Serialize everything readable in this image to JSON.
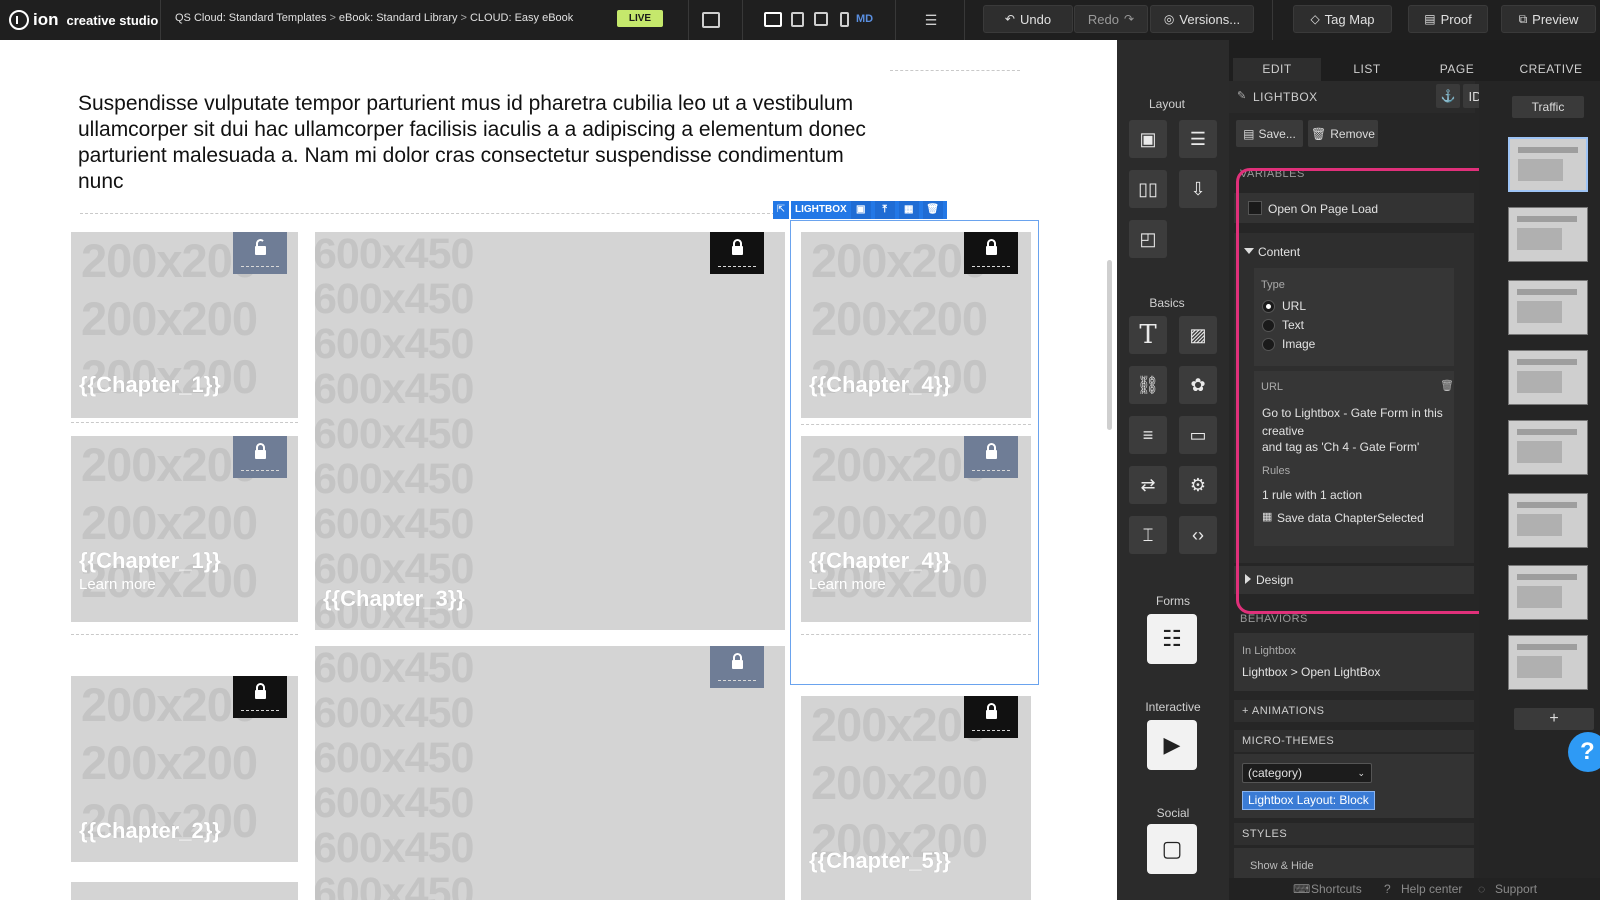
{
  "topbar": {
    "logo": "ion",
    "logo_sub": "creative studio",
    "breadcrumb": [
      "QS Cloud: Standard Templates",
      "eBook: Standard Library",
      "CLOUD: Easy eBook"
    ],
    "crumb_sep": ">",
    "live": "LIVE",
    "device_label": "MD",
    "undo": "Undo",
    "redo": "Redo",
    "versions": "Versions...",
    "tag_map": "Tag Map",
    "proof": "Proof",
    "preview": "Preview"
  },
  "canvas": {
    "paragraph": "Suspendisse vulputate tempor parturient mus id pharetra cubilia leo ut a vestibulum ullamcorper sit dui hac ullamcorper facilisis iaculis a a adipiscing a elementum donec parturient malesuada a. Nam mi dolor cras consectetur suspendisse condimentum nunc",
    "placeholder_small": "200x200",
    "placeholder_wide": "600x450",
    "lightbox_tag": "LIGHTBOX",
    "tiles": [
      {
        "chapter": "{{Chapter_1}}",
        "learn": ""
      },
      {
        "chapter": "{{Chapter_1}}",
        "learn": "Learn more"
      },
      {
        "chapter": "{{Chapter_2}}",
        "learn": ""
      },
      {
        "chapter": "{{Chapter_3}}",
        "learn": ""
      },
      {
        "chapter": "{{Chapter_4}}",
        "learn": ""
      },
      {
        "chapter": "{{Chapter_4}}",
        "learn": "Learn more"
      },
      {
        "chapter": "{{Chapter_5}}",
        "learn": ""
      }
    ]
  },
  "tools": {
    "layout": "Layout",
    "basics": "Basics",
    "forms": "Forms",
    "interactive": "Interactive",
    "social": "Social"
  },
  "panel": {
    "tabs": [
      "EDIT",
      "LIST",
      "PAGE",
      "CREATIVE"
    ],
    "title": "LIGHTBOX",
    "id_label": "ID",
    "save": "Save...",
    "remove": "Remove",
    "variables": "VARIABLES",
    "open_on_load": "Open On Page Load",
    "content": "Content",
    "type_label": "Type",
    "types": [
      "URL",
      "Text",
      "Image"
    ],
    "url_label": "URL",
    "url_text_1": "Go to Lightbox - Gate Form in this creative",
    "url_text_2": "and tag as 'Ch 4 - Gate Form'",
    "rules_label": "Rules",
    "rules_text": "1 rule with 1 action",
    "rule_action": "Save data ChapterSelected",
    "design": "Design",
    "behaviors": "BEHAVIORS",
    "in_lightbox": "In Lightbox",
    "behavior_action": "Lightbox > Open LightBox",
    "animations": "+ ANIMATIONS",
    "micro_themes": "MICRO-THEMES",
    "category": "(category)",
    "theme_chip": "Lightbox Layout: Block",
    "styles": "STYLES",
    "show_hide": "Show & Hide"
  },
  "thumbs": {
    "traffic": "Traffic",
    "add": "+"
  },
  "footer": {
    "shortcuts": "Shortcuts",
    "help": "Help center",
    "support": "Support"
  },
  "help_button": "?",
  "colors": {
    "accent": "#2378e6",
    "highlight": "#e0307a",
    "live": "#c5e86c",
    "lock_blue": "#6f7d96"
  }
}
